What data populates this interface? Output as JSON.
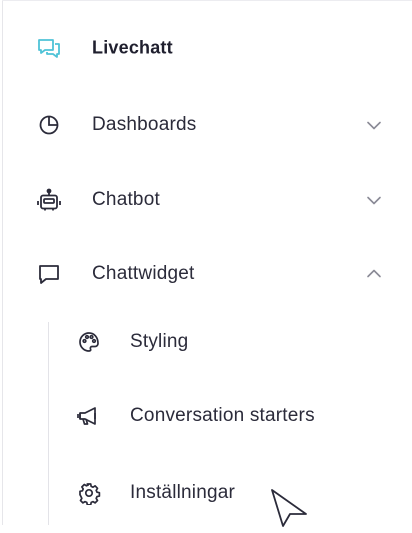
{
  "sidebar": {
    "items": [
      {
        "label": "Livechatt",
        "icon": "chat-bubbles-icon",
        "expanded": null,
        "active": true
      },
      {
        "label": "Dashboards",
        "icon": "pie-chart-icon",
        "expanded": false
      },
      {
        "label": "Chatbot",
        "icon": "robot-icon",
        "expanded": false
      },
      {
        "label": "Chattwidget",
        "icon": "chat-bubble-icon",
        "expanded": true
      }
    ],
    "subitems": [
      {
        "label": "Styling",
        "icon": "palette-icon"
      },
      {
        "label": "Conversation starters",
        "icon": "megaphone-icon"
      },
      {
        "label": "Inställningar",
        "icon": "gear-icon"
      }
    ]
  },
  "colors": {
    "accent": "#4fc3d7",
    "text": "#2b2b3a",
    "icon": "#2b2b3a",
    "chevron": "#8a8a96"
  }
}
